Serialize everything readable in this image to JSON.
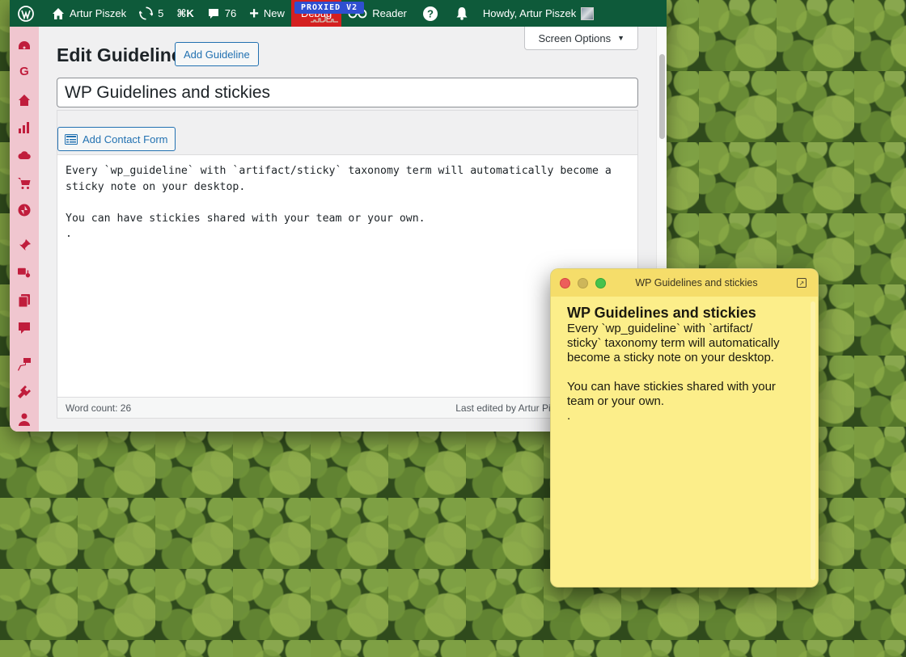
{
  "adminbar": {
    "site_name": "Artur Piszek",
    "updates_count": "5",
    "shortcut": "⌘K",
    "comments_count": "76",
    "new_label": "New",
    "proxied_label": "PROXIED V2",
    "debug_label": "Debug",
    "reader_label": "Reader",
    "howdy": "Howdy, Artur Piszek"
  },
  "screen_options": "Screen Options",
  "page": {
    "title": "Edit Guideline",
    "add_button": "Add Guideline",
    "post_title": "WP Guidelines and stickies"
  },
  "editor": {
    "add_contact_form": "Add Contact Form",
    "content_line1": "Every `wp_guideline` with `artifact/sticky` taxonomy term will automatically become a",
    "content_line2": "sticky note on your desktop.",
    "content_line3": "",
    "content_line4": "You can have stickies shared with your team or your own.",
    "content_line5": ".",
    "word_count": "Word count: 26",
    "last_edited": "Last edited by Artur Piszek on May 20, 2"
  },
  "sticky": {
    "window_title": "WP Guidelines and stickies",
    "heading": "WP Guidelines and stickies",
    "body": "Every `wp_guideline` with `artifact/\nsticky` taxonomy term will automatically\nbecome a sticky note on your desktop.\n\nYou can have stickies shared with your\nteam or your own.\n."
  },
  "colors": {
    "adminbar_bg": "#0e5a3a",
    "sidebar_bg": "#f0c6cf",
    "sidebar_icon": "#c01d3c",
    "debug_bg": "#d42020",
    "sticky_bg": "#fcee8a",
    "link_blue": "#2271b1"
  },
  "sidebar_icons": [
    "dashboard-icon",
    "g-icon",
    "home-icon",
    "stats-icon",
    "cloud-icon",
    "cart-icon",
    "jetpack-icon",
    "pin-icon",
    "media-icon",
    "pages-icon",
    "comments-icon",
    "appearance-icon",
    "plugins-icon",
    "users-icon"
  ]
}
